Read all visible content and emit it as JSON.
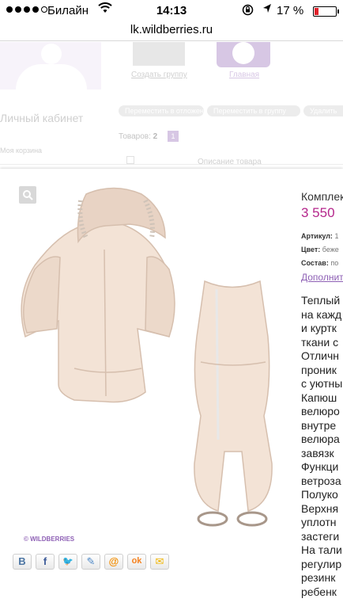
{
  "status_bar": {
    "carrier": "Билайн",
    "time": "14:13",
    "battery_percent": "17 %",
    "battery_level": 0.17
  },
  "browser": {
    "url": "lk.wildberries.ru"
  },
  "background": {
    "create_group": "Создать группу",
    "main_link": "Главная",
    "cabinet_title": "Личный кабинет",
    "basket": "Моя корзина",
    "goods_label": "Товаров:",
    "goods_count": "2",
    "page": "1",
    "description_header": "Описание товара",
    "action_buttons": [
      "Переместить в отложенные",
      "Переместить в группу",
      "Удалить"
    ]
  },
  "product": {
    "title": "Комплект",
    "price": "3 550",
    "article_label": "Артикул:",
    "article_value": "1",
    "color_label": "Цвет:",
    "color_value": "беже",
    "composition_label": "Состав:",
    "composition_value": "по",
    "more_link": "Дополнит",
    "watermark": "© WILDBERRIES",
    "description_lines": [
      "Теплый",
      "на кажд",
      "и куртк",
      "ткани с",
      "Отличн",
      "проник",
      "с уютны",
      "Капюш",
      "велюро",
      "внутре",
      "велюра",
      "завязк",
      "Функци",
      "ветроза",
      "Полуко",
      "Верхня",
      "уплотн",
      "застеги",
      "На тали",
      "регулир",
      "резинк",
      "ребенк"
    ]
  },
  "share_icons": [
    {
      "name": "vk-icon",
      "glyph": "B",
      "color": "#4c75a3"
    },
    {
      "name": "facebook-icon",
      "glyph": "f",
      "color": "#3b5998"
    },
    {
      "name": "twitter-icon",
      "glyph": "🐦",
      "color": "#2aa9e0"
    },
    {
      "name": "livejournal-icon",
      "glyph": "✎",
      "color": "#4a86c5"
    },
    {
      "name": "mailru-icon",
      "glyph": "@",
      "color": "#f28c00"
    },
    {
      "name": "odnoklassniki-icon",
      "glyph": "ok",
      "color": "#f58220"
    },
    {
      "name": "email-icon",
      "glyph": "✉",
      "color": "#f0b400"
    }
  ]
}
